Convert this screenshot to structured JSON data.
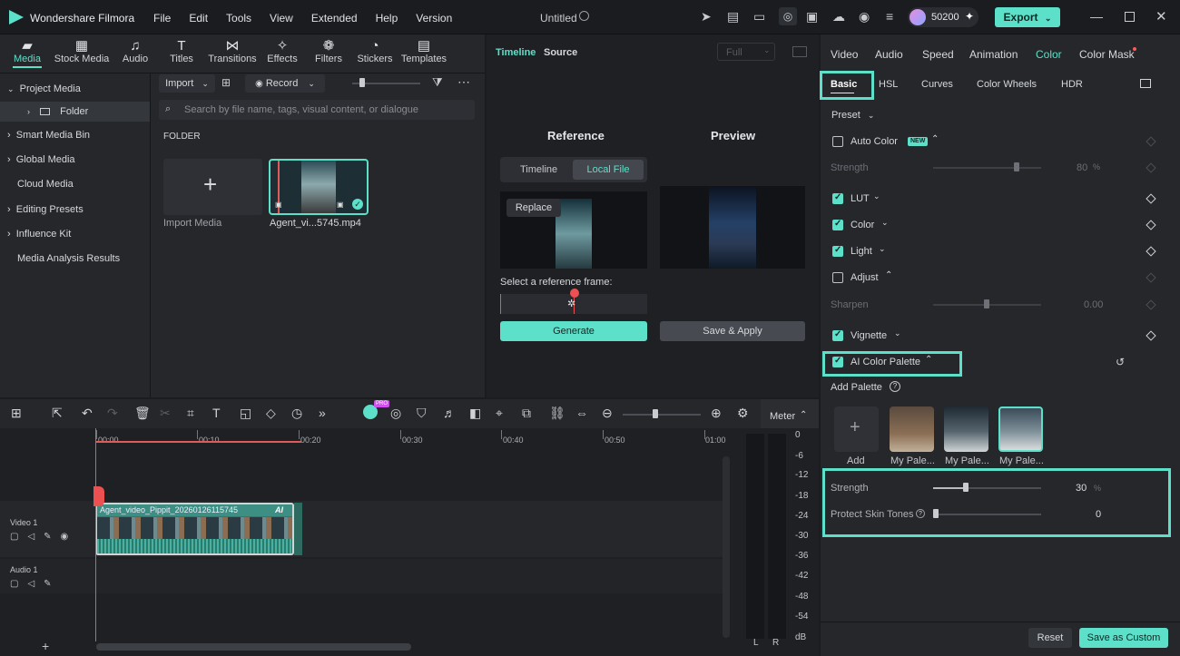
{
  "app": {
    "name": "Wondershare Filmora",
    "doc_title": "Untitled",
    "credits": "50200",
    "export_label": "Export"
  },
  "menu": [
    "File",
    "Edit",
    "Tools",
    "View",
    "Extended",
    "Help",
    "Version"
  ],
  "media_tabs": [
    "Media",
    "Stock Media",
    "Audio",
    "Titles",
    "Transitions",
    "Effects",
    "Filters",
    "Stickers",
    "Templates"
  ],
  "sidebar": {
    "items": [
      "Project Media",
      "Folder",
      "Smart Media Bin",
      "Global Media",
      "Cloud Media",
      "Editing Presets",
      "Influence Kit",
      "Media Analysis Results"
    ]
  },
  "library": {
    "import_label": "Import",
    "record_label": "Record",
    "search_placeholder": "Search by file name, tags, visual content, or dialogue",
    "folder_heading": "FOLDER",
    "import_media_label": "Import Media",
    "clip_name": "Agent_vi...5745.mp4"
  },
  "viewer": {
    "tab_timeline": "Timeline",
    "tab_source": "Source",
    "quality": "Full",
    "reference_label": "Reference",
    "preview_label": "Preview",
    "seg_timeline": "Timeline",
    "seg_local": "Local File",
    "replace_label": "Replace",
    "select_frame_label": "Select a reference frame:",
    "generate_label": "Generate",
    "save_apply_label": "Save & Apply"
  },
  "inspector": {
    "tabs": [
      "Video",
      "Audio",
      "Speed",
      "Animation",
      "Color",
      "Color Mask"
    ],
    "subtabs": [
      "Basic",
      "HSL",
      "Curves",
      "Color Wheels",
      "HDR"
    ],
    "preset_label": "Preset",
    "auto_color": "Auto Color",
    "new_badge": "NEW",
    "strength_label": "Strength",
    "strength_value": "80",
    "percent": "%",
    "lut": "LUT",
    "color": "Color",
    "light": "Light",
    "adjust": "Adjust",
    "sharpen": "Sharpen",
    "sharpen_value": "0.00",
    "vignette": "Vignette",
    "ai_palette": "AI Color Palette",
    "add_palette": "Add Palette",
    "add_label": "Add",
    "palette_names": [
      "My Pale...",
      "My Pale...",
      "My Pale..."
    ],
    "palette_strength_label": "Strength",
    "palette_strength_value": "30",
    "palette_strength_level": 30,
    "protect_label": "Protect Skin Tones",
    "protect_value": "0",
    "reset_label": "Reset",
    "save_custom_label": "Save as Custom"
  },
  "timeline": {
    "meter_label": "Meter",
    "ruler": [
      "00:00",
      "00:10",
      "00:20",
      "00:30",
      "00:40",
      "00:50",
      "01:00"
    ],
    "db_scale": [
      "0",
      "-6",
      "-12",
      "-18",
      "-24",
      "-30",
      "-36",
      "-42",
      "-48",
      "-54",
      "dB"
    ],
    "lr": [
      "L",
      "R"
    ],
    "video_track": "Video 1",
    "audio_track": "Audio 1",
    "clip_label": "Agent_video_Pippit_20260126115745",
    "ai_badge": "AI",
    "pro_badge": "PRO"
  },
  "colors": {
    "accent": "#5ce0c9",
    "bg": "#1b1c1f",
    "panel": "#25272b"
  }
}
